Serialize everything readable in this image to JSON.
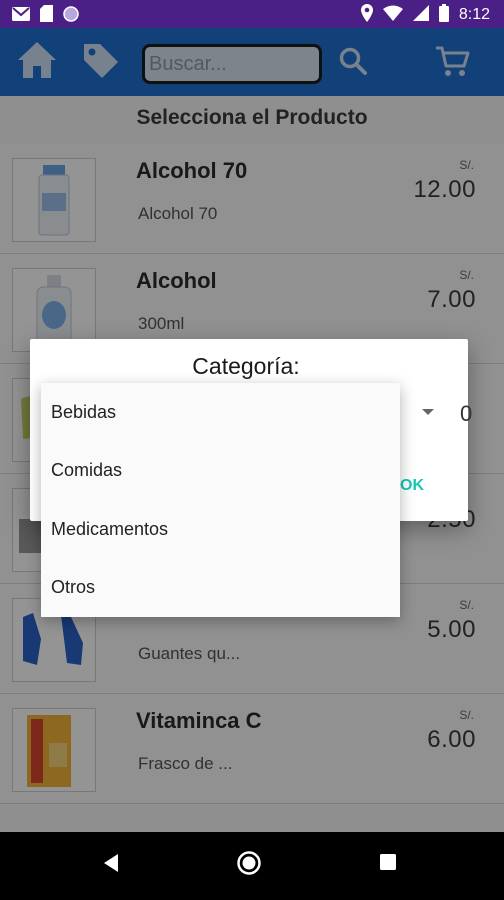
{
  "status_bar": {
    "time": "8:12",
    "colors": {
      "background": "#4a1f86"
    },
    "icons": [
      "mail-icon",
      "sim-card-icon",
      "circle-notification-icon",
      "location-icon",
      "wifi-icon",
      "signal-icon",
      "battery-icon"
    ]
  },
  "toolbar": {
    "search_placeholder": "Buscar...",
    "icons": [
      "home-icon",
      "tag-icon",
      "search-icon",
      "cart-icon"
    ],
    "colors": {
      "background": "#1f6fcf"
    }
  },
  "page": {
    "title": "Selecciona el Producto"
  },
  "products": [
    {
      "name": "Alcohol 70",
      "description": "Alcohol 70",
      "currency": "S/.",
      "price": "12.00"
    },
    {
      "name": "Alcohol",
      "description": "300ml",
      "currency": "S/.",
      "price": "7.00"
    },
    {
      "name": "",
      "description": "",
      "currency": "",
      "price": "0"
    },
    {
      "name": "",
      "description": "",
      "currency": "",
      "price": "2.50"
    },
    {
      "name": "",
      "description": "Guantes qu...",
      "currency": "S/.",
      "price": "5.00"
    },
    {
      "name": "Vitaminca C",
      "description": "Frasco de ...",
      "currency": "S/.",
      "price": "6.00"
    }
  ],
  "dialog": {
    "title": "Categoría:",
    "ok_label": "OK",
    "colors": {
      "accent": "#16c7b6"
    }
  },
  "dropdown": {
    "options": [
      "Bebidas",
      "Comidas",
      "Medicamentos",
      "Otros"
    ]
  },
  "nav_bar": {
    "icons": [
      "back-icon",
      "home-nav-icon",
      "recents-icon"
    ]
  }
}
